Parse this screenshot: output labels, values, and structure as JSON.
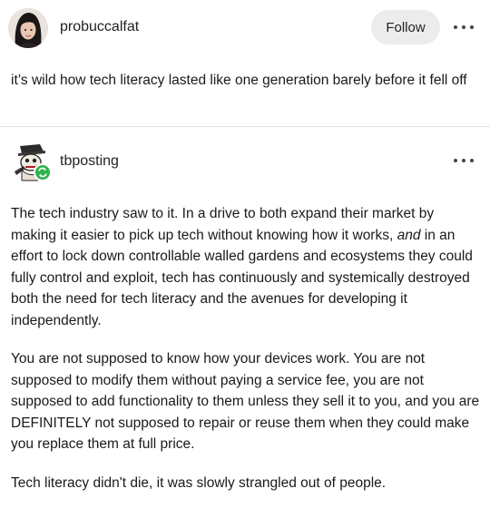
{
  "post": {
    "author": "probuccalfat",
    "follow_label": "Follow",
    "text": "it’s wild how tech literacy lasted like one generation barely before it fell off"
  },
  "reply": {
    "author": "tbposting",
    "paragraphs": {
      "p1_before": "The tech industry saw to it. In a drive to both expand their market by making it easier to pick up tech without knowing how it works, ",
      "p1_em": "and",
      "p1_after": " in an effort to lock down controllable walled gardens and ecosystems they could fully control and exploit, tech has continuously and systemically destroyed both the need for tech literacy and the avenues for developing it independently.",
      "p2": "You are not supposed to know how your devices work. You are not supposed to modify them without paying a service fee, you are not supposed to add functionality to them unless they sell it to you, and you are DEFINITELY not supposed to repair or reuse them when they could make you replace them at full price.",
      "p3": "Tech literacy didn't die, it was slowly strangled out of people."
    }
  },
  "icons": {
    "menu": "more-horizontal-icon",
    "reblog": "reblog-badge-icon"
  },
  "colors": {
    "follow_bg": "#ececec",
    "badge_green": "#2fb24c"
  }
}
